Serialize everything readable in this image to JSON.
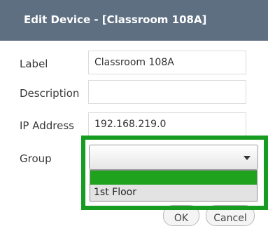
{
  "dialog": {
    "title": "Edit Device - [Classroom 108A]",
    "colors": {
      "titlebar": "#5e6f82",
      "highlight": "#169c21",
      "selected_option": "#1fa31f"
    }
  },
  "form": {
    "label_label": "Label",
    "label_value": "Classroom 108A",
    "description_label": "Description",
    "description_value": "",
    "ip_label": "IP Address",
    "ip_value": "192.168.219.0",
    "group_label": "Group",
    "group_selected": "",
    "group_options": [
      "",
      "1st Floor"
    ]
  },
  "buttons": {
    "ok": "OK",
    "cancel": "Cancel"
  }
}
